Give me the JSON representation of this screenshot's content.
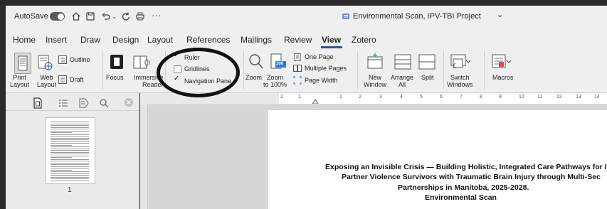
{
  "titlebar": {
    "autosave_label": "AutoSave",
    "more": "···",
    "doc_title": "Environmental Scan, IPV-TBI Project",
    "doc_title_chevron": "⌄"
  },
  "tabs": [
    {
      "label": "Home"
    },
    {
      "label": "Insert"
    },
    {
      "label": "Draw"
    },
    {
      "label": "Design"
    },
    {
      "label": "Layout"
    },
    {
      "label": "References"
    },
    {
      "label": "Mailings"
    },
    {
      "label": "Review"
    },
    {
      "label": "View",
      "active": true
    },
    {
      "label": "Zotero"
    }
  ],
  "ribbon": {
    "print_layout": "Print\nLayout",
    "web_layout": "Web\nLayout",
    "outline": "Outline",
    "draft": "Draft",
    "focus": "Focus",
    "immersive_reader": "Immersive\nReader",
    "ruler": "Ruler",
    "gridlines": "Gridlines",
    "navigation_pane": "Navigation Pane",
    "ruler_checked": true,
    "gridlines_checked": false,
    "navigation_pane_checked": true,
    "zoom": "Zoom",
    "zoom_100": "Zoom\nto 100%",
    "one_page": "One Page",
    "multiple_pages": "Multiple Pages",
    "page_width": "Page Width",
    "new_window": "New\nWindow",
    "arrange_all": "Arrange\nAll",
    "split": "Split",
    "switch_windows": "Switch\nWindows",
    "macros": "Macros",
    "zoom_badge": "100"
  },
  "navpane": {
    "page_number": "1"
  },
  "ruler_numbers": [
    "2",
    "1",
    "1",
    "2",
    "3",
    "4",
    "5",
    "6",
    "7",
    "8",
    "9",
    "10",
    "11",
    "12",
    "13",
    "14"
  ],
  "document": {
    "line1": "Exposing an Invisible Crisis — Building Holistic, Integrated Care Pathways for I",
    "line2": "Partner Violence Survivors with Traumatic Brain Injury through Multi-Sec",
    "line3": "Partnerships in Manitoba, 2025-2028.",
    "line4": "Environmental Scan"
  },
  "colors": {
    "accent": "#2b5797",
    "ribbon_bg": "#efefef",
    "canvas_bg": "#d6d6d6",
    "annotation": "#111111"
  }
}
